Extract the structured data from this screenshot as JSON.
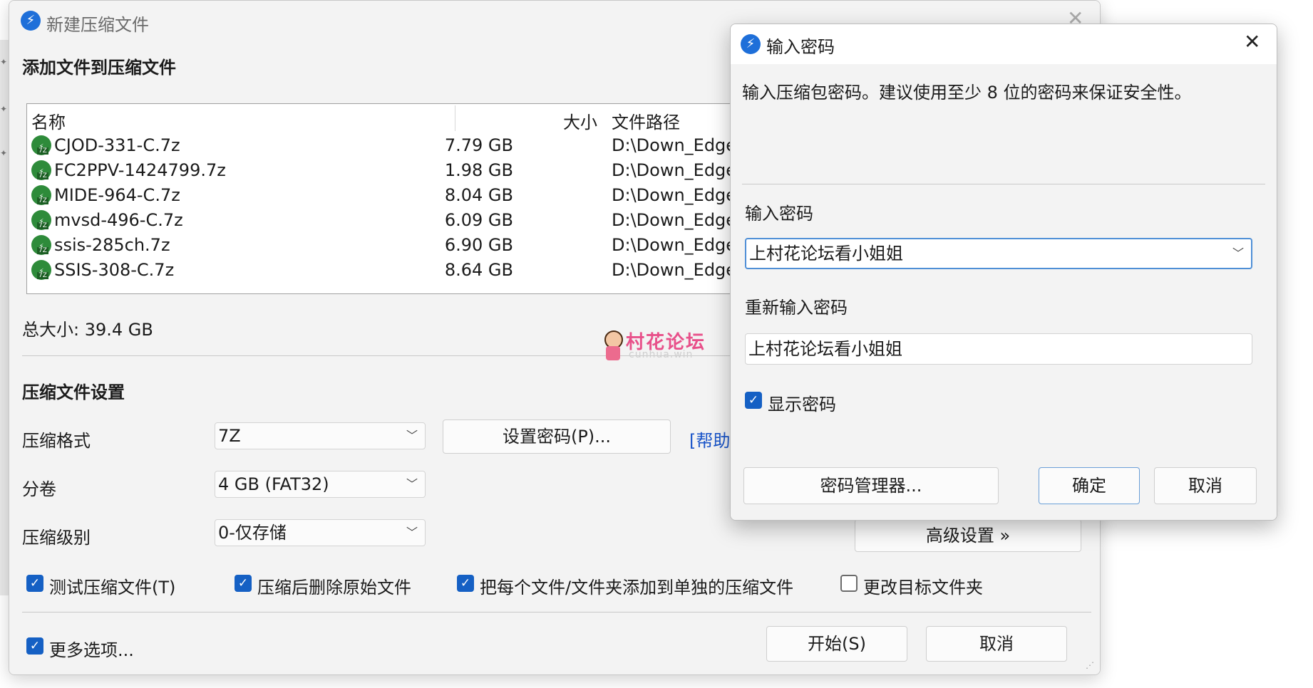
{
  "main_window": {
    "title": "新建压缩文件",
    "close_glyph": "✕",
    "section_add_title": "添加文件到压缩文件",
    "columns": {
      "name": "名称",
      "size": "大小",
      "path": "文件路径"
    },
    "files": [
      {
        "name": "CJOD-331-C.7z",
        "size": "7.79 GB",
        "path": "D:\\Down_Edge\\"
      },
      {
        "name": "FC2PPV-1424799.7z",
        "size": "1.98 GB",
        "path": "D:\\Down_Edge\\"
      },
      {
        "name": "MIDE-964-C.7z",
        "size": "8.04 GB",
        "path": "D:\\Down_Edge\\"
      },
      {
        "name": "mvsd-496-C.7z",
        "size": "6.09 GB",
        "path": "D:\\Down_Edge\\"
      },
      {
        "name": "ssis-285ch.7z",
        "size": "6.90 GB",
        "path": "D:\\Down_Edge\\"
      },
      {
        "name": "SSIS-308-C.7z",
        "size": "8.64 GB",
        "path": "D:\\Down_Edge\\"
      }
    ],
    "total_size": "总大小: 39.4 GB",
    "section_settings_title": "压缩文件设置",
    "format_label": "压缩格式",
    "format_value": "7Z",
    "set_password_button": "设置密码(P)...",
    "help_link": "[帮助]",
    "volume_label": "分卷",
    "volume_value": "4 GB (FAT32)",
    "level_label": "压缩级别",
    "level_value": "0-仅存储",
    "advanced_button": "高级设置 »",
    "checkboxes": [
      {
        "label": "测试压缩文件(T)",
        "checked": true
      },
      {
        "label": "压缩后删除原始文件",
        "checked": true
      },
      {
        "label": "把每个文件/文件夹添加到单独的压缩文件",
        "checked": true
      },
      {
        "label": "更改目标文件夹",
        "checked": false
      }
    ],
    "more_options": {
      "label": "更多选项...",
      "checked": true
    },
    "start_button": "开始(S)",
    "cancel_button": "取消"
  },
  "watermark": {
    "text": "村花论坛",
    "sub": "cunhua.win"
  },
  "password_dialog": {
    "title": "输入密码",
    "close_glyph": "✕",
    "description": "输入压缩包密码。建议使用至少 8 位的密码来保证安全性。",
    "password_label": "输入密码",
    "password_value": "上村花论坛看小姐姐",
    "confirm_label": "重新输入密码",
    "confirm_value": "上村花论坛看小姐姐",
    "show_password": {
      "label": "显示密码",
      "checked": true
    },
    "manager_button": "密码管理器...",
    "ok_button": "确定",
    "cancel_button": "取消"
  },
  "colors": {
    "accent": "#1560c4",
    "app_icon": "#1e6fd9",
    "watermark": "#e8508a"
  },
  "icons": [
    "bandizip-app-icon",
    "7z-file-icon",
    "close-icon",
    "chevron-down-icon",
    "checkmark-icon"
  ]
}
